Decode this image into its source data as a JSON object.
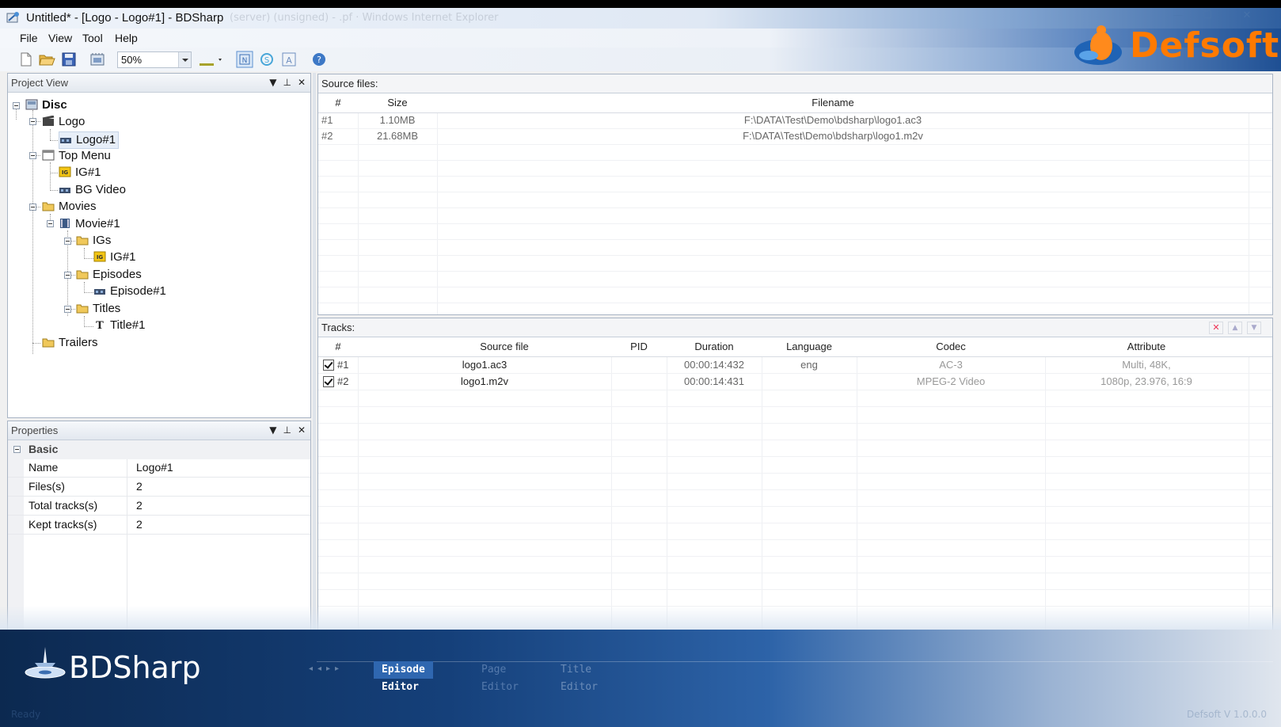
{
  "window": {
    "title": "Untitled* - [Logo - Logo#1] - BDSharp",
    "ghost_text": "(server) (unsigned) - .pf ·  Windows Internet Explorer"
  },
  "menu": {
    "items": [
      "File",
      "View",
      "Tool",
      "Help"
    ]
  },
  "toolbar": {
    "zoom_value": "50%"
  },
  "brand": {
    "name": "Defsoft"
  },
  "project_view": {
    "title": "Project View",
    "tree": {
      "disc": "Disc",
      "logo": "Logo",
      "logo1": "Logo#1",
      "top_menu": "Top Menu",
      "ig1": "IG#1",
      "bg_video": "BG Video",
      "movies": "Movies",
      "movie1": "Movie#1",
      "igs": "IGs",
      "movie_ig1": "IG#1",
      "episodes": "Episodes",
      "episode1": "Episode#1",
      "titles": "Titles",
      "title1": "Title#1",
      "trailers": "Trailers"
    }
  },
  "properties": {
    "title": "Properties",
    "section": "Basic",
    "rows": [
      {
        "name": "Name",
        "value": "Logo#1"
      },
      {
        "name": "Files(s)",
        "value": "2"
      },
      {
        "name": "Total tracks(s)",
        "value": "2"
      },
      {
        "name": "Kept tracks(s)",
        "value": "2"
      }
    ]
  },
  "source_files": {
    "title": "Source files:",
    "columns": [
      "#",
      "Size",
      "Filename"
    ],
    "rows": [
      {
        "num": "#1",
        "size": "1.10MB",
        "filename": "F:\\DATA\\Test\\Demo\\bdsharp\\logo1.ac3"
      },
      {
        "num": "#2",
        "size": "21.68MB",
        "filename": "F:\\DATA\\Test\\Demo\\bdsharp\\logo1.m2v"
      }
    ]
  },
  "tracks": {
    "title": "Tracks:",
    "columns": [
      "#",
      "Source file",
      "PID",
      "Duration",
      "Language",
      "Codec",
      "Attribute"
    ],
    "rows": [
      {
        "num": "#1",
        "source": "logo1.ac3",
        "pid": "",
        "duration": "00:00:14:432",
        "language": "eng",
        "codec": "AC-3",
        "attribute": "Multi, 48K,"
      },
      {
        "num": "#2",
        "source": "logo1.m2v",
        "pid": "",
        "duration": "00:00:14:431",
        "language": "",
        "codec": "MPEG-2 Video",
        "attribute": "1080p, 23.976, 16:9"
      }
    ]
  },
  "bottom": {
    "app_name": "BDSharp",
    "tabs": [
      "Episode Editor",
      "Page Editor",
      "Title Editor"
    ],
    "status_left": "Ready",
    "status_right": "Defsoft V 1.0.0.0"
  },
  "colors": {
    "accent": "#2d63a8",
    "brand_orange": "#ff7a00"
  }
}
